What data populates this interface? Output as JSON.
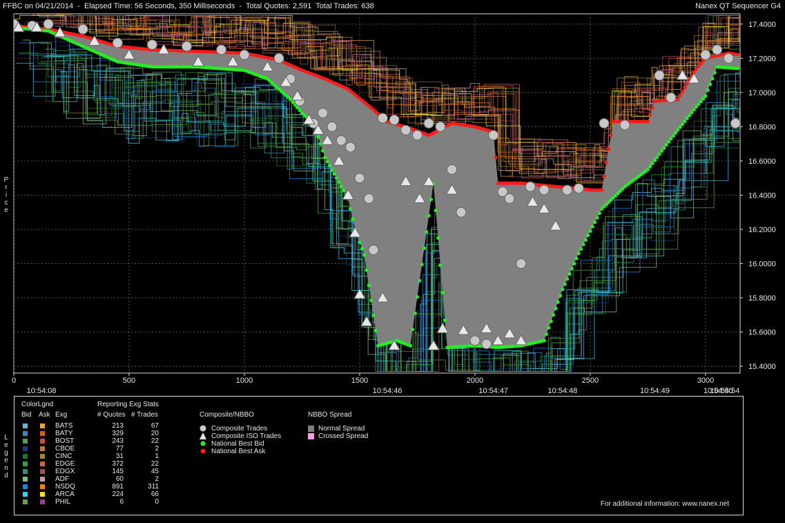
{
  "header": {
    "title": "FFBC on 04/21/2014  -  Elapsed Time: 56 Seconds, 350 Milliseconds  -  Total Quotes: 2,591  Total Trades: 638",
    "app": "Nanex QT Sequencer G4"
  },
  "side_labels": {
    "price": "Price",
    "legend": "Legend"
  },
  "chart_data": {
    "type": "line",
    "ylabel": "Price",
    "x_range": [
      0,
      3150
    ],
    "y_range": [
      15.36,
      17.46
    ],
    "y_ticks": [
      "17.4000",
      "17.2000",
      "17.0000",
      "16.8000",
      "16.6000",
      "16.4000",
      "16.2000",
      "16.0000",
      "15.8000",
      "15.6000",
      "15.4000"
    ],
    "y_tick_values": [
      17.4,
      17.2,
      17.0,
      16.8,
      16.6,
      16.4,
      16.2,
      16.0,
      15.8,
      15.6,
      15.4
    ],
    "x_ticks": [
      "0",
      "500",
      "1000",
      "1500",
      "2000",
      "2500",
      "3000"
    ],
    "x_tick_values": [
      0,
      500,
      1000,
      1500,
      2000,
      2500,
      3000
    ],
    "time_ticks": [
      {
        "label": "10:54:08",
        "x": 120
      },
      {
        "label": "10:54:46",
        "x": 1620
      },
      {
        "label": "10:54:47",
        "x": 2080
      },
      {
        "label": "10:54:48",
        "x": 2380
      },
      {
        "label": "10:54:49",
        "x": 2780
      },
      {
        "label": "10:54:50",
        "x": 3055
      },
      {
        "label": "10:54:54",
        "x": 3150
      }
    ],
    "grid": true,
    "series": [
      {
        "name": "National Best Ask",
        "color": "#ff1a1a",
        "points": [
          [
            0,
            17.39
          ],
          [
            150,
            17.37
          ],
          [
            300,
            17.33
          ],
          [
            450,
            17.27
          ],
          [
            600,
            17.25
          ],
          [
            800,
            17.24
          ],
          [
            1000,
            17.23
          ],
          [
            1150,
            17.19
          ],
          [
            1250,
            17.13
          ],
          [
            1350,
            17.08
          ],
          [
            1450,
            17.02
          ],
          [
            1550,
            16.91
          ],
          [
            1620,
            16.83
          ],
          [
            1720,
            16.79
          ],
          [
            1800,
            16.75
          ],
          [
            1900,
            16.82
          ],
          [
            2000,
            16.8
          ],
          [
            2080,
            16.77
          ],
          [
            2100,
            16.47
          ],
          [
            2200,
            16.47
          ],
          [
            2350,
            16.45
          ],
          [
            2450,
            16.44
          ],
          [
            2500,
            16.43
          ],
          [
            2550,
            16.43
          ],
          [
            2600,
            16.83
          ],
          [
            2700,
            16.83
          ],
          [
            2750,
            16.83
          ],
          [
            2780,
            16.95
          ],
          [
            2880,
            16.96
          ],
          [
            2950,
            17.12
          ],
          [
            3000,
            17.2
          ],
          [
            3100,
            17.23
          ],
          [
            3150,
            17.22
          ]
        ]
      },
      {
        "name": "National Best Bid",
        "color": "#22ee22",
        "points": [
          [
            0,
            17.38
          ],
          [
            150,
            17.36
          ],
          [
            300,
            17.27
          ],
          [
            450,
            17.18
          ],
          [
            600,
            17.15
          ],
          [
            800,
            17.15
          ],
          [
            1000,
            17.13
          ],
          [
            1100,
            17.08
          ],
          [
            1200,
            16.96
          ],
          [
            1250,
            16.88
          ],
          [
            1300,
            16.82
          ],
          [
            1350,
            16.62
          ],
          [
            1400,
            16.5
          ],
          [
            1450,
            16.38
          ],
          [
            1480,
            16.2
          ],
          [
            1520,
            16.05
          ],
          [
            1580,
            15.52
          ],
          [
            1660,
            15.55
          ],
          [
            1720,
            15.52
          ],
          [
            1820,
            16.47
          ],
          [
            1880,
            15.51
          ],
          [
            2000,
            15.52
          ],
          [
            2100,
            15.51
          ],
          [
            2200,
            15.52
          ],
          [
            2300,
            15.55
          ],
          [
            2380,
            15.85
          ],
          [
            2450,
            16.06
          ],
          [
            2550,
            16.32
          ],
          [
            2650,
            16.45
          ],
          [
            2750,
            16.55
          ],
          [
            2850,
            16.73
          ],
          [
            2950,
            16.9
          ],
          [
            3000,
            16.98
          ],
          [
            3050,
            17.15
          ],
          [
            3150,
            17.14
          ]
        ]
      }
    ],
    "trades": [
      [
        0,
        17.4
      ],
      [
        80,
        17.39
      ],
      [
        150,
        17.4
      ],
      [
        300,
        17.37
      ],
      [
        450,
        17.29
      ],
      [
        600,
        17.28
      ],
      [
        750,
        17.27
      ],
      [
        900,
        17.25
      ],
      [
        1000,
        17.22
      ],
      [
        1150,
        17.2
      ],
      [
        1200,
        17.08
      ],
      [
        1240,
        16.95
      ],
      [
        1300,
        16.82
      ],
      [
        1340,
        16.88
      ],
      [
        1380,
        16.8
      ],
      [
        1420,
        16.72
      ],
      [
        1460,
        16.68
      ],
      [
        1500,
        16.5
      ],
      [
        1540,
        16.38
      ],
      [
        1560,
        16.08
      ],
      [
        1600,
        16.85
      ],
      [
        1650,
        16.84
      ],
      [
        1700,
        16.78
      ],
      [
        1750,
        16.75
      ],
      [
        1800,
        16.82
      ],
      [
        1850,
        16.8
      ],
      [
        1900,
        16.55
      ],
      [
        1940,
        16.3
      ],
      [
        2000,
        15.55
      ],
      [
        2050,
        15.53
      ],
      [
        2080,
        16.75
      ],
      [
        2120,
        16.42
      ],
      [
        2150,
        16.38
      ],
      [
        2200,
        16.0
      ],
      [
        2240,
        16.45
      ],
      [
        2300,
        16.43
      ],
      [
        2400,
        16.43
      ],
      [
        2450,
        16.44
      ],
      [
        2560,
        16.82
      ],
      [
        2650,
        16.81
      ],
      [
        2800,
        17.1
      ],
      [
        2850,
        16.97
      ],
      [
        3000,
        17.22
      ],
      [
        3050,
        17.25
      ],
      [
        3100,
        17.2
      ],
      [
        3130,
        16.82
      ]
    ],
    "iso_trades": [
      [
        20,
        17.38
      ],
      [
        100,
        17.38
      ],
      [
        200,
        17.35
      ],
      [
        350,
        17.3
      ],
      [
        500,
        17.22
      ],
      [
        650,
        17.25
      ],
      [
        800,
        17.18
      ],
      [
        950,
        17.18
      ],
      [
        1100,
        17.15
      ],
      [
        1180,
        17.06
      ],
      [
        1230,
        16.98
      ],
      [
        1280,
        16.84
      ],
      [
        1320,
        16.78
      ],
      [
        1360,
        16.72
      ],
      [
        1410,
        16.6
      ],
      [
        1450,
        16.4
      ],
      [
        1480,
        16.18
      ],
      [
        1500,
        15.82
      ],
      [
        1530,
        15.66
      ],
      [
        1600,
        15.8
      ],
      [
        1650,
        15.52
      ],
      [
        1700,
        16.48
      ],
      [
        1760,
        16.38
      ],
      [
        1800,
        16.48
      ],
      [
        1820,
        15.52
      ],
      [
        1860,
        15.62
      ],
      [
        1900,
        16.43
      ],
      [
        1950,
        15.61
      ],
      [
        2050,
        15.62
      ],
      [
        2100,
        15.55
      ],
      [
        2150,
        15.59
      ],
      [
        2200,
        15.55
      ],
      [
        2250,
        16.36
      ],
      [
        2300,
        16.32
      ],
      [
        2350,
        16.22
      ],
      [
        2900,
        17.1
      ],
      [
        2950,
        17.08
      ]
    ],
    "legend": {
      "colorlegend_title": "ColorLgnd",
      "col_bid": "Bid",
      "col_ask": "Ask",
      "col_exg": "Exg",
      "stats_title": "Reporting Exg Stats",
      "col_quotes": "# Quotes",
      "col_trades": "# Trades",
      "exchanges": [
        {
          "name": "BATS",
          "bid": "#5bb7e6",
          "ask": "#f0a040",
          "quotes": "213",
          "trades": "67"
        },
        {
          "name": "BATY",
          "bid": "#3a8ac8",
          "ask": "#d06020",
          "quotes": "329",
          "trades": "20"
        },
        {
          "name": "BOST",
          "bid": "#4fa050",
          "ask": "#c05050",
          "quotes": "243",
          "trades": "22"
        },
        {
          "name": "CBOE",
          "bid": "#1a3a8a",
          "ask": "#c07a3a",
          "quotes": "77",
          "trades": "2"
        },
        {
          "name": "CINC",
          "bid": "#1a7a1a",
          "ask": "#a08a20",
          "quotes": "31",
          "trades": "1"
        },
        {
          "name": "EDGE",
          "bid": "#3aa03a",
          "ask": "#c06a4a",
          "quotes": "372",
          "trades": "22"
        },
        {
          "name": "EDGX",
          "bid": "#2a9a6a",
          "ask": "#a0504a",
          "quotes": "145",
          "trades": "45"
        },
        {
          "name": "ADF",
          "bid": "#88b888",
          "ask": "#c0a0a0",
          "quotes": "60",
          "trades": "2"
        },
        {
          "name": "NSDQ",
          "bid": "#1a88e8",
          "ask": "#f08010",
          "quotes": "891",
          "trades": "311"
        },
        {
          "name": "ARCA",
          "bid": "#30d8e8",
          "ask": "#f0e020",
          "quotes": "224",
          "trades": "66"
        },
        {
          "name": "PHIL",
          "bid": "#6aa040",
          "ask": "#a04080",
          "quotes": "6",
          "trades": "0"
        }
      ],
      "composite_title": "Composite/NBBO",
      "composite_items": [
        {
          "label": "Composite Trades",
          "marker": "circle",
          "color": "#c8c8c8"
        },
        {
          "label": "Composite ISO Trades",
          "marker": "triangle",
          "color": "#e8e8e8"
        },
        {
          "label": "National Best Bid",
          "marker": "dot",
          "color": "#22ee22"
        },
        {
          "label": "National Best Ask",
          "marker": "dot",
          "color": "#ff1a1a"
        }
      ],
      "spread_title": "NBBO Spread",
      "spread_items": [
        {
          "label": "Normal Spread",
          "color": "#808080"
        },
        {
          "label": "Crossed Spread",
          "color": "#ff9ce8"
        }
      ]
    }
  },
  "footer": {
    "info": "For additional information: www.nanex.net"
  }
}
